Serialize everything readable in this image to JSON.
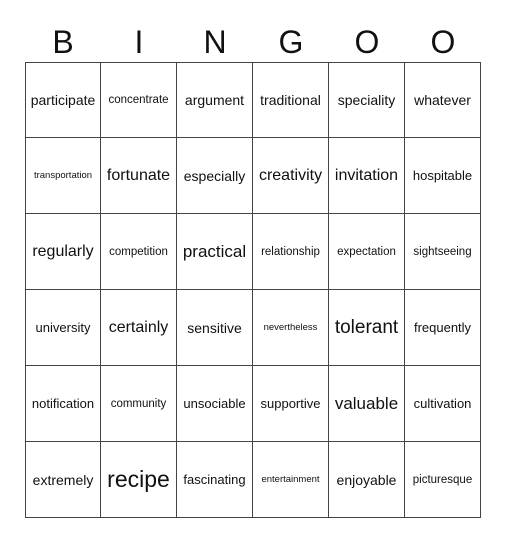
{
  "header": {
    "letters": [
      "B",
      "I",
      "N",
      "G",
      "O",
      "O"
    ]
  },
  "rows": [
    [
      "participate",
      "concentrate",
      "argument",
      "traditional",
      "speciality",
      "whatever"
    ],
    [
      "transportation",
      "fortunate",
      "especially",
      "creativity",
      "invitation",
      "hospitable"
    ],
    [
      "regularly",
      "competition",
      "practical",
      "relationship",
      "expectation",
      "sightseeing"
    ],
    [
      "university",
      "certainly",
      "sensitive",
      "nevertheless",
      "tolerant",
      "frequently"
    ],
    [
      "notification",
      "community",
      "unsociable",
      "supportive",
      "valuable",
      "cultivation"
    ],
    [
      "extremely",
      "recipe",
      "fascinating",
      "entertainment",
      "enjoyable",
      "picturesque"
    ]
  ]
}
